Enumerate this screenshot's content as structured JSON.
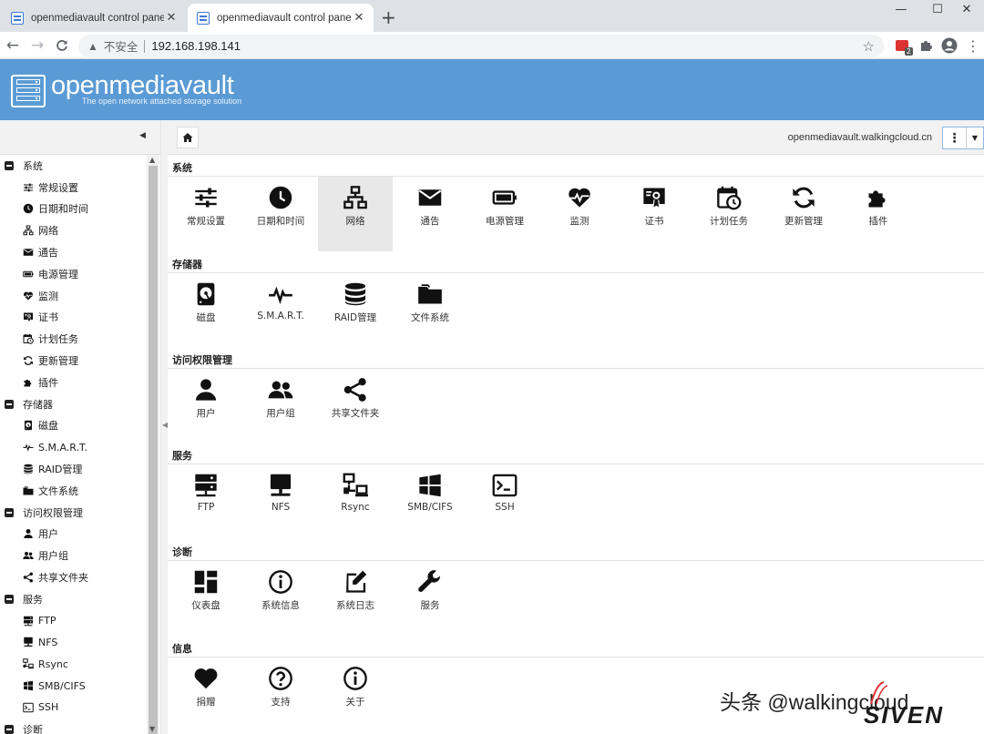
{
  "browser": {
    "tabs": [
      {
        "title": "openmediavault control panel",
        "close": "✕",
        "active": false
      },
      {
        "title": "openmediavault control panel",
        "close": "✕",
        "active": true
      }
    ],
    "new_tab": "+",
    "window_controls": {
      "minimize": "—",
      "maximize": "☐",
      "close": "✕"
    },
    "address": {
      "security_label": "不安全",
      "url": "192.168.198.141"
    },
    "extension_badge": "2"
  },
  "header": {
    "brand": "openmediavault",
    "tagline": "The open network attached storage solution"
  },
  "topbar": {
    "hostname": "openmediavault.walkingcloud.cn"
  },
  "sidebar": {
    "groups": [
      {
        "label": "系统",
        "items": [
          {
            "label": "常规设置",
            "icon": "sliders-icon"
          },
          {
            "label": "日期和时间",
            "icon": "clock-icon"
          },
          {
            "label": "网络",
            "icon": "network-icon"
          },
          {
            "label": "通告",
            "icon": "envelope-icon"
          },
          {
            "label": "电源管理",
            "icon": "battery-icon"
          },
          {
            "label": "监测",
            "icon": "heartbeat-icon"
          },
          {
            "label": "证书",
            "icon": "certificate-icon"
          },
          {
            "label": "计划任务",
            "icon": "calendar-clock-icon"
          },
          {
            "label": "更新管理",
            "icon": "refresh-icon"
          },
          {
            "label": "插件",
            "icon": "puzzle-icon"
          }
        ]
      },
      {
        "label": "存储器",
        "items": [
          {
            "label": "磁盘",
            "icon": "hdd-icon"
          },
          {
            "label": "S.M.A.R.T.",
            "icon": "pulse-icon"
          },
          {
            "label": "RAID管理",
            "icon": "database-icon"
          },
          {
            "label": "文件系统",
            "icon": "folder-icon"
          }
        ]
      },
      {
        "label": "访问权限管理",
        "items": [
          {
            "label": "用户",
            "icon": "user-icon"
          },
          {
            "label": "用户组",
            "icon": "users-icon"
          },
          {
            "label": "共享文件夹",
            "icon": "share-icon"
          }
        ]
      },
      {
        "label": "服务",
        "items": [
          {
            "label": "FTP",
            "icon": "server-icon"
          },
          {
            "label": "NFS",
            "icon": "monitor-icon"
          },
          {
            "label": "Rsync",
            "icon": "sync-computers-icon"
          },
          {
            "label": "SMB/CIFS",
            "icon": "windows-icon"
          },
          {
            "label": "SSH",
            "icon": "terminal-icon"
          }
        ]
      },
      {
        "label": "诊断",
        "items": []
      }
    ]
  },
  "sections": [
    {
      "title": "系统",
      "tiles": [
        {
          "label": "常规设置",
          "icon": "sliders-icon"
        },
        {
          "label": "日期和时间",
          "icon": "clock-icon"
        },
        {
          "label": "网络",
          "icon": "network-icon"
        },
        {
          "label": "通告",
          "icon": "envelope-icon"
        },
        {
          "label": "电源管理",
          "icon": "battery-icon"
        },
        {
          "label": "监测",
          "icon": "heartbeat-icon"
        },
        {
          "label": "证书",
          "icon": "certificate-icon"
        },
        {
          "label": "计划任务",
          "icon": "calendar-clock-icon"
        },
        {
          "label": "更新管理",
          "icon": "refresh-icon"
        },
        {
          "label": "插件",
          "icon": "puzzle-icon"
        }
      ]
    },
    {
      "title": "存储器",
      "tiles": [
        {
          "label": "磁盘",
          "icon": "hdd-icon"
        },
        {
          "label": "S.M.A.R.T.",
          "icon": "pulse-icon"
        },
        {
          "label": "RAID管理",
          "icon": "database-icon"
        },
        {
          "label": "文件系统",
          "icon": "folder-icon"
        }
      ]
    },
    {
      "title": "访问权限管理",
      "tiles": [
        {
          "label": "用户",
          "icon": "user-icon"
        },
        {
          "label": "用户组",
          "icon": "users-icon"
        },
        {
          "label": "共享文件夹",
          "icon": "share-icon"
        }
      ]
    },
    {
      "title": "服务",
      "tiles": [
        {
          "label": "FTP",
          "icon": "server-icon"
        },
        {
          "label": "NFS",
          "icon": "monitor-icon"
        },
        {
          "label": "Rsync",
          "icon": "sync-computers-icon"
        },
        {
          "label": "SMB/CIFS",
          "icon": "windows-icon"
        },
        {
          "label": "SSH",
          "icon": "terminal-icon"
        }
      ]
    },
    {
      "title": "诊断",
      "tiles": [
        {
          "label": "仪表盘",
          "icon": "dashboard-icon"
        },
        {
          "label": "系统信息",
          "icon": "info-circle-icon"
        },
        {
          "label": "系统日志",
          "icon": "edit-log-icon"
        },
        {
          "label": "服务",
          "icon": "wrench-icon"
        }
      ]
    },
    {
      "title": "信息",
      "tiles": [
        {
          "label": "捐赠",
          "icon": "heart-icon"
        },
        {
          "label": "支持",
          "icon": "question-circle-icon"
        },
        {
          "label": "关于",
          "icon": "info-circle-icon"
        }
      ]
    }
  ],
  "watermark": {
    "text": "头条 @walkingcloud",
    "brand": "SIVEN"
  },
  "colors": {
    "header": "#5b9bd5",
    "selected_tile": "#e8e8e8",
    "chrome_tabstrip": "#dee1e6"
  }
}
